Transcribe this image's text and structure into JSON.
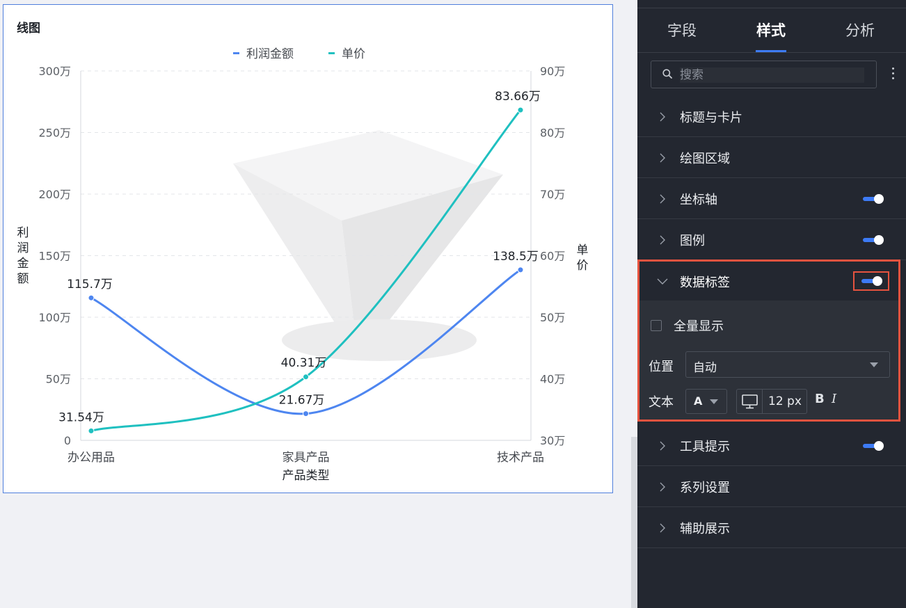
{
  "chart": {
    "title": "线图",
    "axis_titles": {
      "left": "利润金额",
      "right": "单价",
      "bottom": "产品类型"
    }
  },
  "chart_data": {
    "type": "line",
    "categories": [
      "办公用品",
      "家具产品",
      "技术产品"
    ],
    "xlabel": "产品类型",
    "legend_position": "top-center",
    "series": [
      {
        "name": "利润金额",
        "axis": "left",
        "color": "#4e86f0",
        "values": [
          115.7,
          21.67,
          138.5
        ],
        "labels": [
          "115.7万",
          "21.67万",
          "138.5万"
        ]
      },
      {
        "name": "单价",
        "axis": "right",
        "color": "#1fc0c0",
        "values": [
          31.54,
          40.31,
          83.66
        ],
        "labels": [
          "31.54万",
          "40.31万",
          "83.66万"
        ]
      }
    ],
    "y_left": {
      "label": "利润金额",
      "range": [
        0,
        300
      ],
      "ticks": [
        0,
        50,
        100,
        150,
        200,
        250,
        300
      ],
      "tick_labels": [
        "0",
        "50万",
        "100万",
        "150万",
        "200万",
        "250万",
        "300万"
      ]
    },
    "y_right": {
      "label": "单价",
      "range": [
        30,
        90
      ],
      "ticks": [
        30,
        40,
        50,
        60,
        70,
        80,
        90
      ],
      "tick_labels": [
        "30万",
        "40万",
        "50万",
        "60万",
        "70万",
        "80万",
        "90万"
      ]
    },
    "grid": "horizontal-dashed",
    "smooth": true
  },
  "panel": {
    "tabs": [
      {
        "label": "字段",
        "active": false
      },
      {
        "label": "样式",
        "active": true
      },
      {
        "label": "分析",
        "active": false
      }
    ],
    "search_placeholder": "搜索",
    "sections_before": [
      {
        "label": "标题与卡片",
        "toggle": false
      },
      {
        "label": "绘图区域",
        "toggle": false
      },
      {
        "label": "坐标轴",
        "toggle": true
      },
      {
        "label": "图例",
        "toggle": true
      }
    ],
    "data_label_section": {
      "label": "数据标签",
      "enabled": true,
      "show_all_label": "全量显示",
      "show_all_checked": false,
      "position_label": "位置",
      "position_value": "自动",
      "text_label": "文本",
      "text_color_glyph": "A",
      "font_size": "12 px",
      "bold_glyph": "B",
      "italic_glyph": "I"
    },
    "sections_after": [
      {
        "label": "工具提示",
        "toggle": true
      },
      {
        "label": "系列设置",
        "toggle": false
      },
      {
        "label": "辅助展示",
        "toggle": false
      }
    ]
  },
  "colors": {
    "accent": "#3d7bf5",
    "highlight": "#e5533f",
    "panel_bg": "#232730"
  },
  "icons": {
    "search": "search-icon",
    "more": "more-vertical-icon",
    "chevron_right": "chevron-right-icon",
    "chevron_down": "chevron-down-icon",
    "monitor": "monitor-icon"
  }
}
